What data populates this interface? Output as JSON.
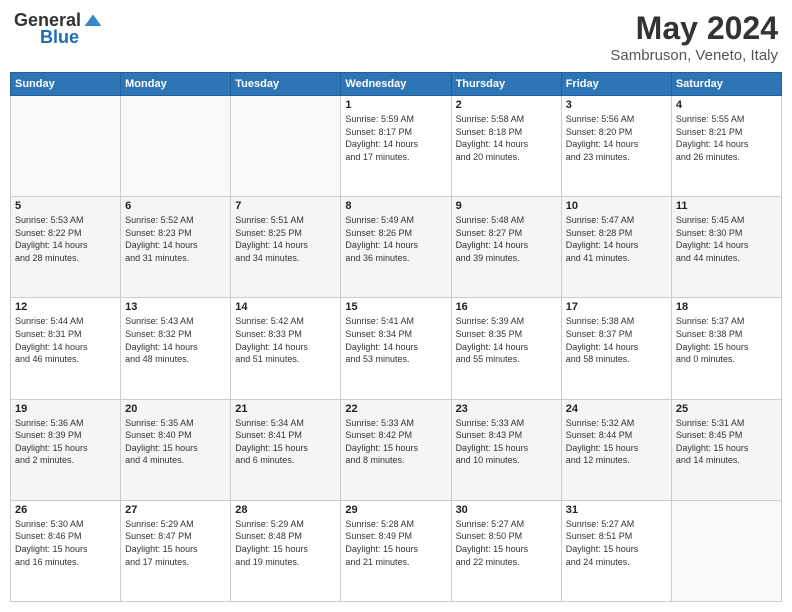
{
  "logo": {
    "text_general": "General",
    "text_blue": "Blue"
  },
  "header": {
    "month": "May 2024",
    "location": "Sambruson, Veneto, Italy"
  },
  "days_of_week": [
    "Sunday",
    "Monday",
    "Tuesday",
    "Wednesday",
    "Thursday",
    "Friday",
    "Saturday"
  ],
  "weeks": [
    [
      {
        "day": "",
        "info": ""
      },
      {
        "day": "",
        "info": ""
      },
      {
        "day": "",
        "info": ""
      },
      {
        "day": "1",
        "info": "Sunrise: 5:59 AM\nSunset: 8:17 PM\nDaylight: 14 hours\nand 17 minutes."
      },
      {
        "day": "2",
        "info": "Sunrise: 5:58 AM\nSunset: 8:18 PM\nDaylight: 14 hours\nand 20 minutes."
      },
      {
        "day": "3",
        "info": "Sunrise: 5:56 AM\nSunset: 8:20 PM\nDaylight: 14 hours\nand 23 minutes."
      },
      {
        "day": "4",
        "info": "Sunrise: 5:55 AM\nSunset: 8:21 PM\nDaylight: 14 hours\nand 26 minutes."
      }
    ],
    [
      {
        "day": "5",
        "info": "Sunrise: 5:53 AM\nSunset: 8:22 PM\nDaylight: 14 hours\nand 28 minutes."
      },
      {
        "day": "6",
        "info": "Sunrise: 5:52 AM\nSunset: 8:23 PM\nDaylight: 14 hours\nand 31 minutes."
      },
      {
        "day": "7",
        "info": "Sunrise: 5:51 AM\nSunset: 8:25 PM\nDaylight: 14 hours\nand 34 minutes."
      },
      {
        "day": "8",
        "info": "Sunrise: 5:49 AM\nSunset: 8:26 PM\nDaylight: 14 hours\nand 36 minutes."
      },
      {
        "day": "9",
        "info": "Sunrise: 5:48 AM\nSunset: 8:27 PM\nDaylight: 14 hours\nand 39 minutes."
      },
      {
        "day": "10",
        "info": "Sunrise: 5:47 AM\nSunset: 8:28 PM\nDaylight: 14 hours\nand 41 minutes."
      },
      {
        "day": "11",
        "info": "Sunrise: 5:45 AM\nSunset: 8:30 PM\nDaylight: 14 hours\nand 44 minutes."
      }
    ],
    [
      {
        "day": "12",
        "info": "Sunrise: 5:44 AM\nSunset: 8:31 PM\nDaylight: 14 hours\nand 46 minutes."
      },
      {
        "day": "13",
        "info": "Sunrise: 5:43 AM\nSunset: 8:32 PM\nDaylight: 14 hours\nand 48 minutes."
      },
      {
        "day": "14",
        "info": "Sunrise: 5:42 AM\nSunset: 8:33 PM\nDaylight: 14 hours\nand 51 minutes."
      },
      {
        "day": "15",
        "info": "Sunrise: 5:41 AM\nSunset: 8:34 PM\nDaylight: 14 hours\nand 53 minutes."
      },
      {
        "day": "16",
        "info": "Sunrise: 5:39 AM\nSunset: 8:35 PM\nDaylight: 14 hours\nand 55 minutes."
      },
      {
        "day": "17",
        "info": "Sunrise: 5:38 AM\nSunset: 8:37 PM\nDaylight: 14 hours\nand 58 minutes."
      },
      {
        "day": "18",
        "info": "Sunrise: 5:37 AM\nSunset: 8:38 PM\nDaylight: 15 hours\nand 0 minutes."
      }
    ],
    [
      {
        "day": "19",
        "info": "Sunrise: 5:36 AM\nSunset: 8:39 PM\nDaylight: 15 hours\nand 2 minutes."
      },
      {
        "day": "20",
        "info": "Sunrise: 5:35 AM\nSunset: 8:40 PM\nDaylight: 15 hours\nand 4 minutes."
      },
      {
        "day": "21",
        "info": "Sunrise: 5:34 AM\nSunset: 8:41 PM\nDaylight: 15 hours\nand 6 minutes."
      },
      {
        "day": "22",
        "info": "Sunrise: 5:33 AM\nSunset: 8:42 PM\nDaylight: 15 hours\nand 8 minutes."
      },
      {
        "day": "23",
        "info": "Sunrise: 5:33 AM\nSunset: 8:43 PM\nDaylight: 15 hours\nand 10 minutes."
      },
      {
        "day": "24",
        "info": "Sunrise: 5:32 AM\nSunset: 8:44 PM\nDaylight: 15 hours\nand 12 minutes."
      },
      {
        "day": "25",
        "info": "Sunrise: 5:31 AM\nSunset: 8:45 PM\nDaylight: 15 hours\nand 14 minutes."
      }
    ],
    [
      {
        "day": "26",
        "info": "Sunrise: 5:30 AM\nSunset: 8:46 PM\nDaylight: 15 hours\nand 16 minutes."
      },
      {
        "day": "27",
        "info": "Sunrise: 5:29 AM\nSunset: 8:47 PM\nDaylight: 15 hours\nand 17 minutes."
      },
      {
        "day": "28",
        "info": "Sunrise: 5:29 AM\nSunset: 8:48 PM\nDaylight: 15 hours\nand 19 minutes."
      },
      {
        "day": "29",
        "info": "Sunrise: 5:28 AM\nSunset: 8:49 PM\nDaylight: 15 hours\nand 21 minutes."
      },
      {
        "day": "30",
        "info": "Sunrise: 5:27 AM\nSunset: 8:50 PM\nDaylight: 15 hours\nand 22 minutes."
      },
      {
        "day": "31",
        "info": "Sunrise: 5:27 AM\nSunset: 8:51 PM\nDaylight: 15 hours\nand 24 minutes."
      },
      {
        "day": "",
        "info": ""
      }
    ]
  ]
}
